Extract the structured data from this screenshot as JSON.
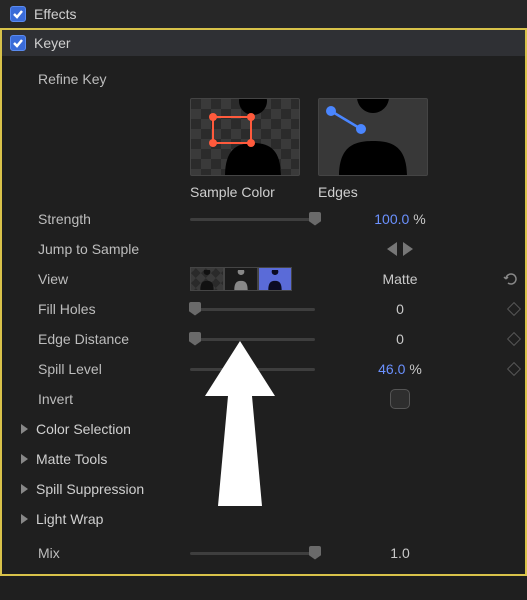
{
  "effects": {
    "label": "Effects"
  },
  "keyer": {
    "label": "Keyer"
  },
  "refine": {
    "label": "Refine Key"
  },
  "thumbs": {
    "sample": "Sample Color",
    "edges": "Edges"
  },
  "strength": {
    "label": "Strength",
    "value": "100.0",
    "pct": "%",
    "pos": 100
  },
  "jump": {
    "label": "Jump to Sample"
  },
  "view": {
    "label": "View",
    "value": "Matte"
  },
  "fill": {
    "label": "Fill Holes",
    "value": "0",
    "pos": 4
  },
  "edge": {
    "label": "Edge Distance",
    "value": "0",
    "pos": 4
  },
  "spill": {
    "label": "Spill Level",
    "value": "46.0",
    "pct": "%",
    "pos": 46
  },
  "invert": {
    "label": "Invert"
  },
  "groups": {
    "color": "Color Selection",
    "matte": "Matte Tools",
    "spillg": "Spill Suppression",
    "light": "Light Wrap"
  },
  "mix": {
    "label": "Mix",
    "value": "1.0",
    "pos": 100
  }
}
